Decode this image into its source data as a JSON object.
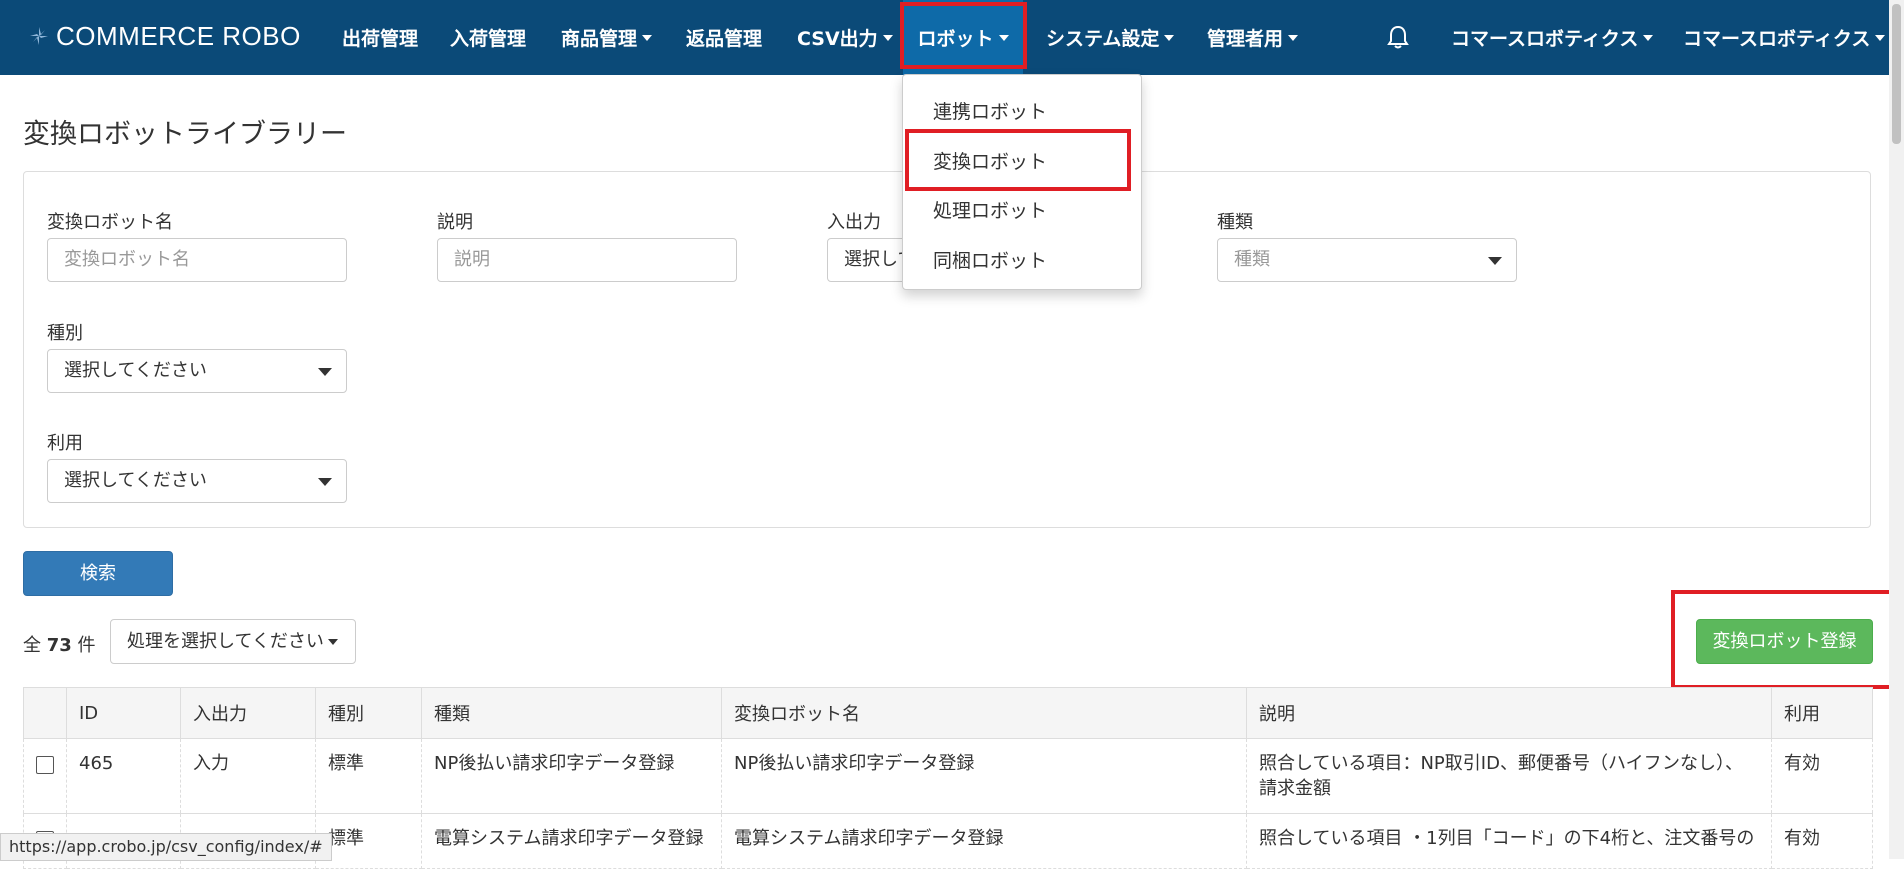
{
  "brand": {
    "name": "COMMERCE ROBO"
  },
  "nav": {
    "items": [
      "出荷管理",
      "入荷管理",
      "商品管理",
      "返品管理",
      "CSV出力",
      "ロボット",
      "システム設定",
      "管理者用"
    ],
    "right_items": [
      "コマースロボティクス",
      "コマースロボティクス"
    ],
    "active": "ロボット"
  },
  "robot_menu": {
    "items": [
      "連携ロボット",
      "変換ロボット",
      "処理ロボット",
      "同梱ロボット"
    ],
    "highlighted": "変換ロボット"
  },
  "page": {
    "title": "変換ロボットライブラリー"
  },
  "filters": {
    "name_label": "変換ロボット名",
    "name_placeholder": "変換ロボット名",
    "desc_label": "説明",
    "desc_placeholder": "説明",
    "io_label": "入出力",
    "io_value": "選択して",
    "kind_label": "種類",
    "kind_placeholder": "種類",
    "type_label": "種別",
    "type_value": "選択してください",
    "use_label": "利用",
    "use_value": "選択してください"
  },
  "search_button": "検索",
  "results": {
    "total_prefix": "全",
    "total_count": "73",
    "total_suffix": "件",
    "action_select": "処理を選択してください",
    "register_button": "変換ロボット登録"
  },
  "table": {
    "headers": [
      "ID",
      "入出力",
      "種別",
      "種類",
      "変換ロボット名",
      "説明",
      "利用"
    ],
    "rows": [
      [
        "465",
        "入力",
        "標準",
        "NP後払い請求印字データ登録",
        "NP後払い請求印字データ登録",
        "照合している項目：NP取引ID、郵便番号（ハイフンなし）、請求金額",
        "有効"
      ],
      [
        "",
        "",
        "標準",
        "電算システム請求印字データ登録",
        "電算システム請求印字データ登録",
        "照合している項目 ・1列目「コード」の下4桁と、注文番号の",
        "有効"
      ]
    ]
  },
  "status_url": "https://app.crobo.jp/csv_config/index/#",
  "colors": {
    "navbar": "#0b4a78",
    "active_nav": "#0e6aa8",
    "highlight": "#e01e24",
    "primary": "#337ab7",
    "success": "#5cb85c"
  }
}
